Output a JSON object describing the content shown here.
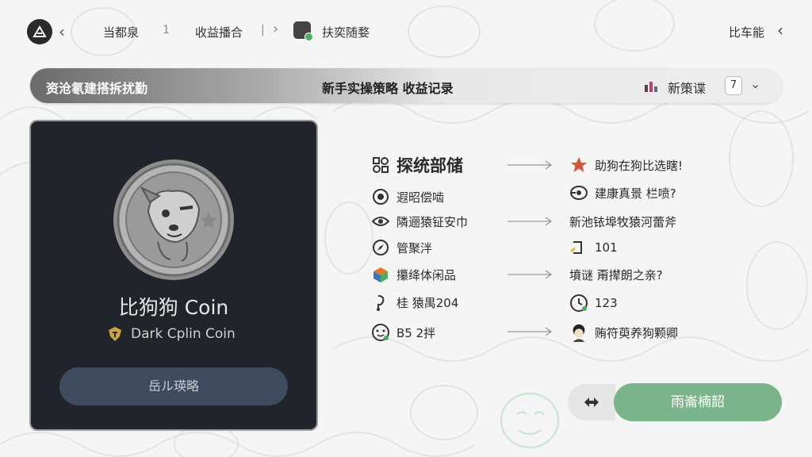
{
  "colors": {
    "accent_green": "#79b48a",
    "card_bg": "#22242b",
    "button_dark": "#3e4a5d"
  },
  "topbar": {
    "crumbs": [
      "当都泉",
      "1",
      "收益播合",
      "|",
      "扶奕随婺"
    ],
    "right_label": "比车能"
  },
  "banner": {
    "left_label": "资沧氡建搭拆扰勤",
    "center_label": "新手实操策略  收益记录",
    "right_label": "新策谍",
    "badge": "7"
  },
  "card": {
    "title": "比狗狗 Coin",
    "subtitle": "Dark Cplin Coin",
    "button_label": "岳ル瑛略"
  },
  "list": {
    "title": "探统部储",
    "left": [
      "遐昭偿啮",
      "隣逦猿钲安巾",
      "管聚泮",
      "攥绛体闲品",
      "桂 猿禺204",
      "B5 2拌"
    ],
    "right": [
      "助狗在狗比选瞎!",
      "建康真景 栏喷?",
      "新池铱埠牧猿河蕾斧",
      "101",
      "墳谜 甭撵朗之亲?",
      "123",
      "贿符萸养狗颗卿"
    ]
  },
  "actions": {
    "primary_label": "雨崙楠韶"
  },
  "icons": {
    "logo": "leaf-logo-icon",
    "back": "chevron-left-icon",
    "next": "chevron-right-icon",
    "star": "star-icon",
    "chart": "bar-chart-icon",
    "dropdown": "chevron-down-icon"
  }
}
